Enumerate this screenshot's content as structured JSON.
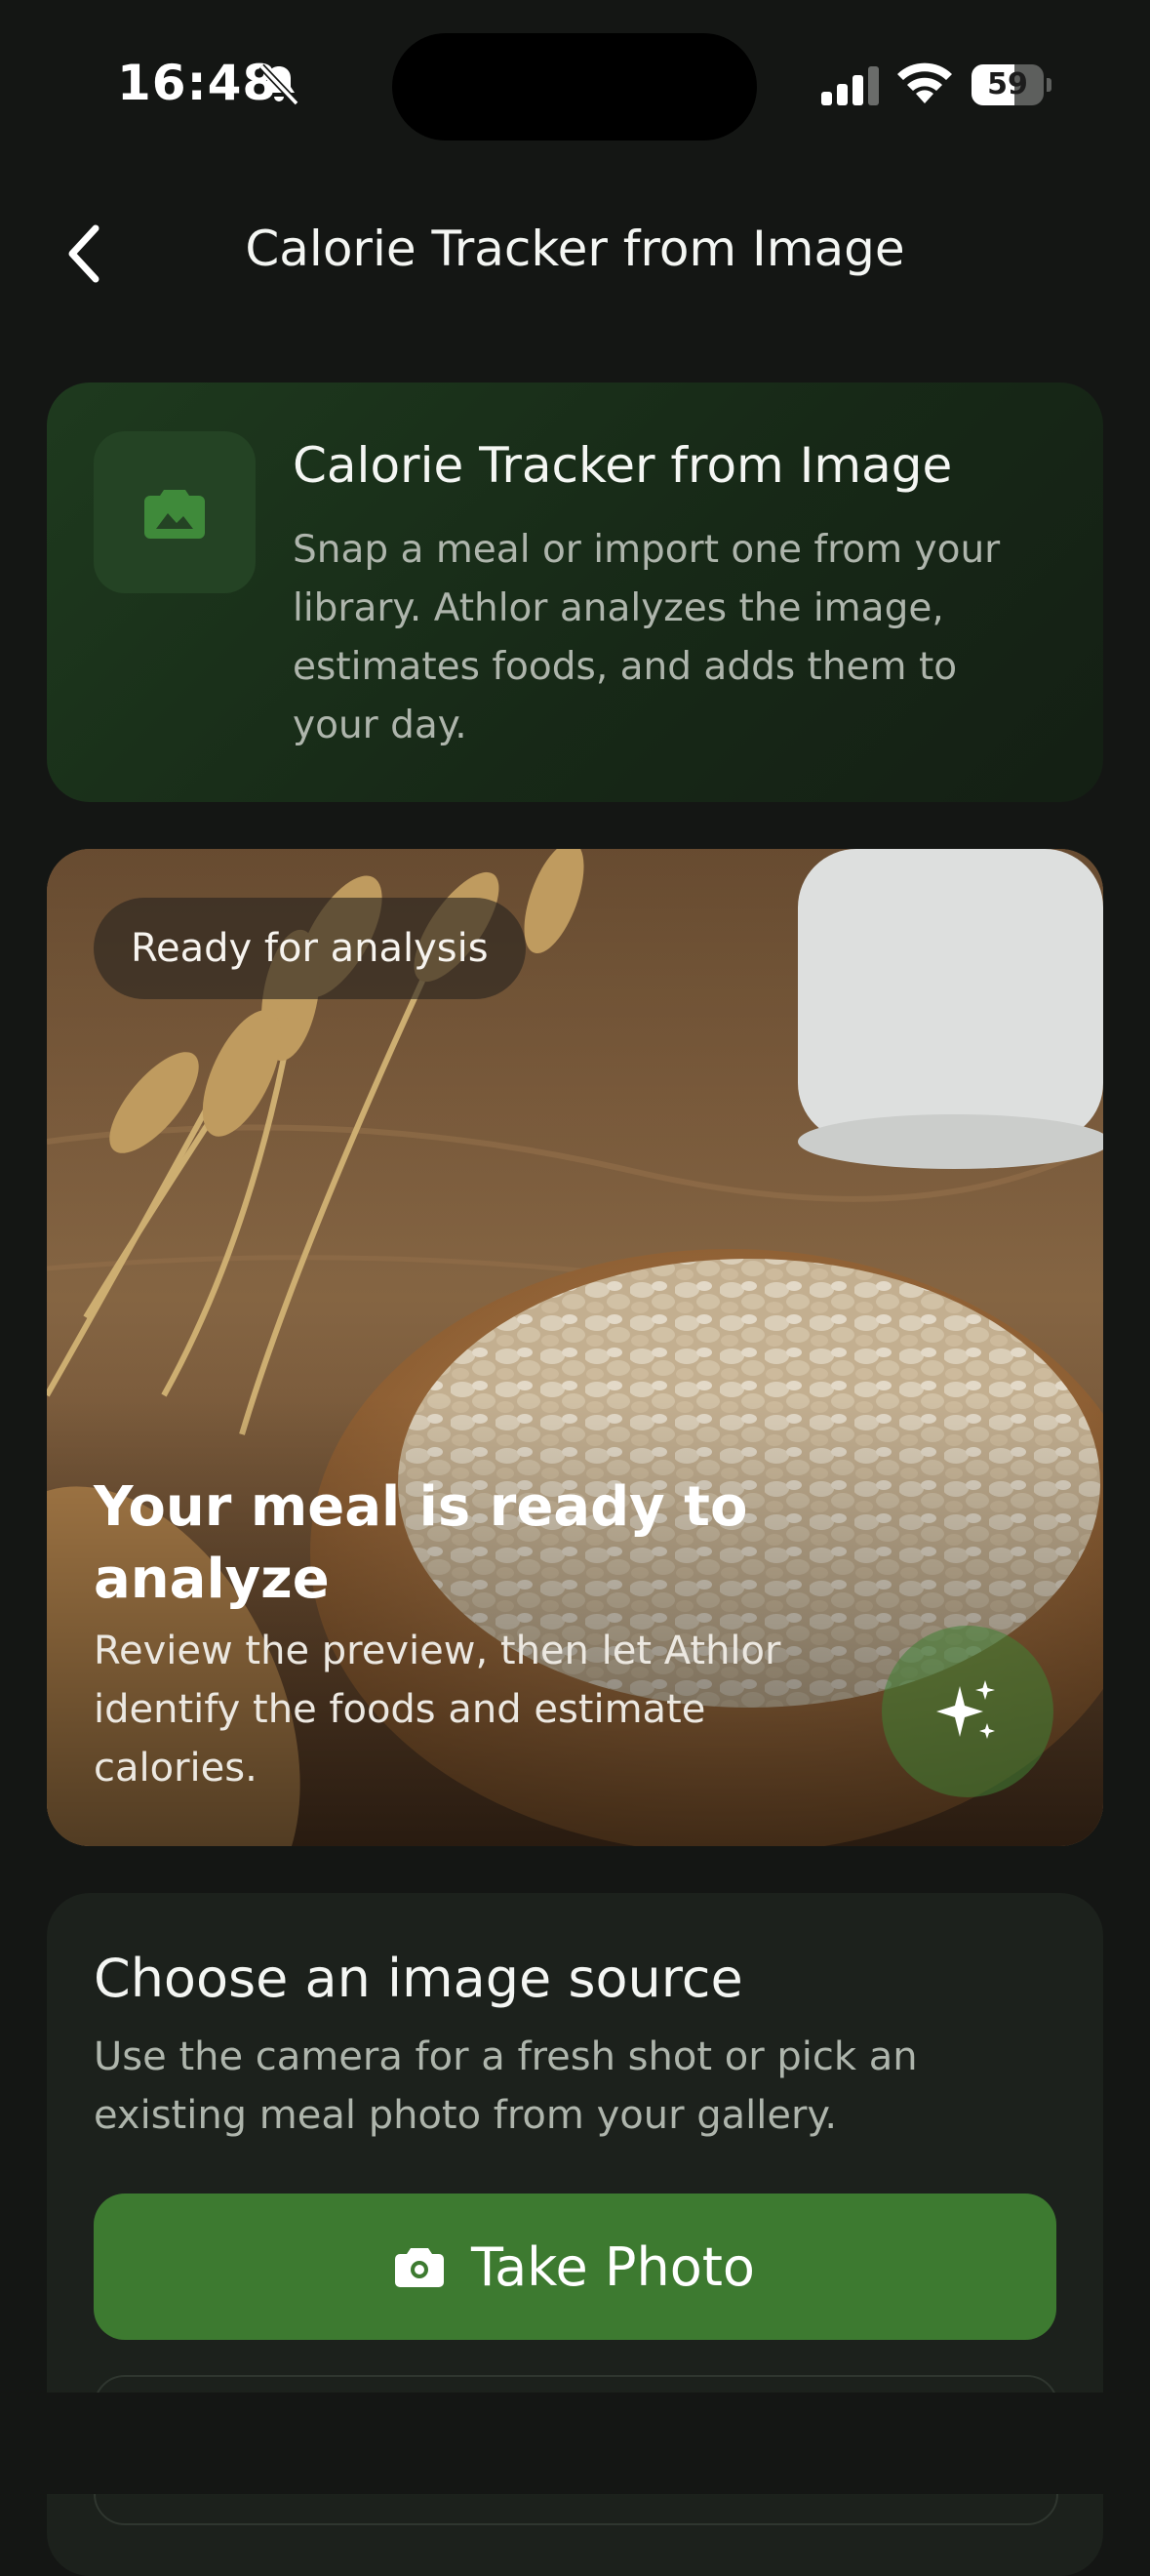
{
  "status_bar": {
    "time": "16:48",
    "battery_level": 59,
    "battery_text": "59"
  },
  "nav": {
    "title": "Calorie Tracker from Image"
  },
  "intro": {
    "title": "Calorie Tracker from Image",
    "description": "Snap a meal or import one from your library. Athlor analyzes the image, estimates foods, and adds them to your day."
  },
  "preview": {
    "badge": "Ready for analysis",
    "title": "Your meal is ready to analyze",
    "description": "Review the preview, then let Athlor identify the foods and estimate calories."
  },
  "source": {
    "title": "Choose an image source",
    "description": "Use the camera for a fresh shot or pick an existing meal photo from your gallery.",
    "take_photo_label": "Take Photo"
  },
  "colors": {
    "background": "#141614",
    "accent_green": "#3d7a30",
    "card": "#1c211c"
  },
  "icons": {
    "back": "chevron-left-icon",
    "intro": "image-camera-icon",
    "sparkle": "sparkles-icon",
    "camera": "camera-icon"
  }
}
